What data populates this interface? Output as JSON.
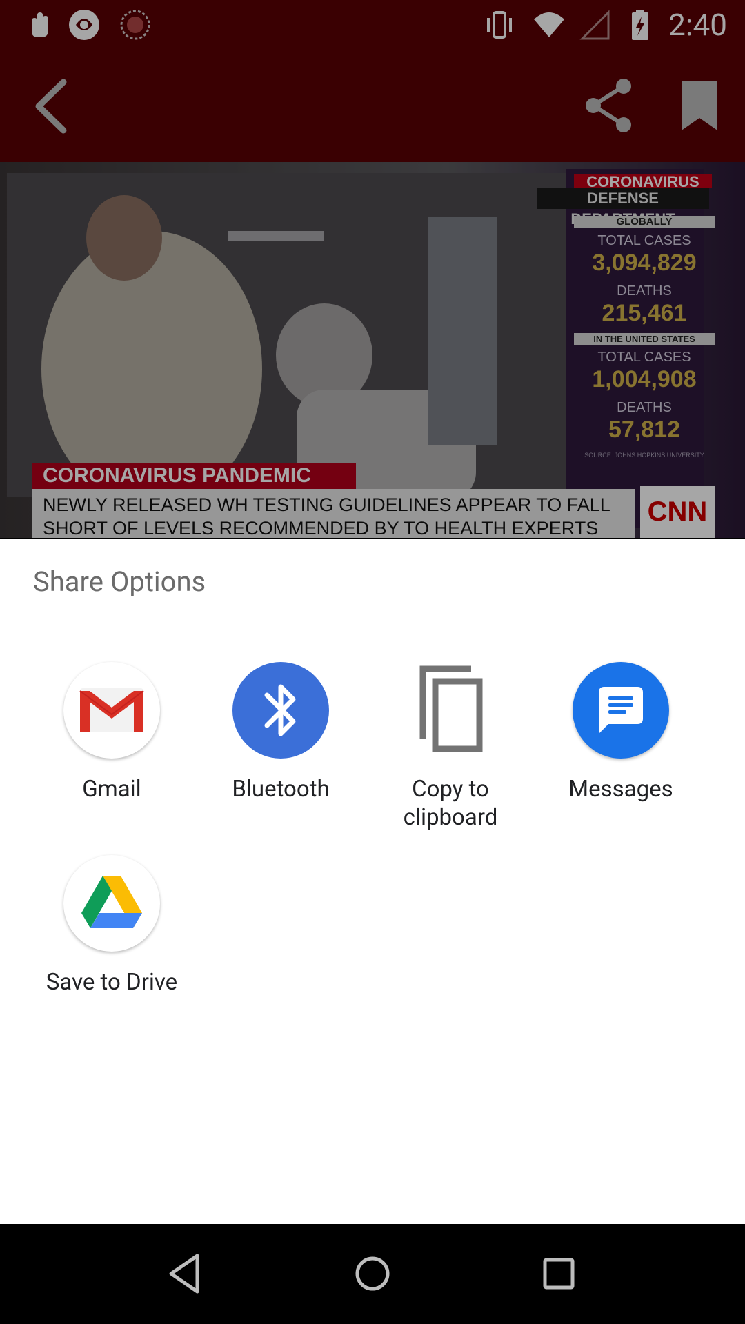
{
  "status_bar": {
    "time": "2:40",
    "icons": [
      "hand-icon",
      "app-badge-icon",
      "sync-icon",
      "vibrate-icon",
      "wifi-icon",
      "signal-icon",
      "battery-charging-icon"
    ]
  },
  "app_bar": {
    "icons": [
      "back-arrow-icon",
      "share-icon",
      "bookmark-icon"
    ]
  },
  "media": {
    "overlay": {
      "top_tag": "CORONAVIRUS",
      "tag2": "DEFENSE DEPARTMENT",
      "globally": "GLOBALLY",
      "total_cases_label": "TOTAL CASES",
      "total_cases_global": "3,094,829",
      "deaths_label": "DEATHS",
      "deaths_global": "215,461",
      "us_label": "IN THE UNITED STATES",
      "total_cases_us": "1,004,908",
      "deaths_us": "57,812",
      "source": "SOURCE: JOHNS HOPKINS UNIVERSITY",
      "lower_third_title": "CORONAVIRUS PANDEMIC",
      "lower_third_line1": "NEWLY RELEASED WH TESTING GUIDELINES APPEAR TO FALL",
      "lower_third_line2": "SHORT OF LEVELS RECOMMENDED BY TO HEALTH EXPERTS",
      "brand": "CNN"
    }
  },
  "share_sheet": {
    "title": "Share Options",
    "targets": [
      {
        "label": "Gmail",
        "icon": "gmail-icon"
      },
      {
        "label": "Bluetooth",
        "icon": "bluetooth-icon"
      },
      {
        "label_line1": "Copy to",
        "label_line2": "clipboard",
        "icon": "copy-icon"
      },
      {
        "label": "Messages",
        "icon": "messages-icon"
      },
      {
        "label": "Save to Drive",
        "icon": "drive-icon"
      }
    ]
  },
  "nav_bar": {
    "icons": [
      "back-nav-icon",
      "home-nav-icon",
      "recents-nav-icon"
    ]
  },
  "colors": {
    "app_bar": "#5a0004",
    "bluetooth": "#3b6fd8",
    "messages": "#1a73e8",
    "cnn_red": "#cc0000"
  }
}
